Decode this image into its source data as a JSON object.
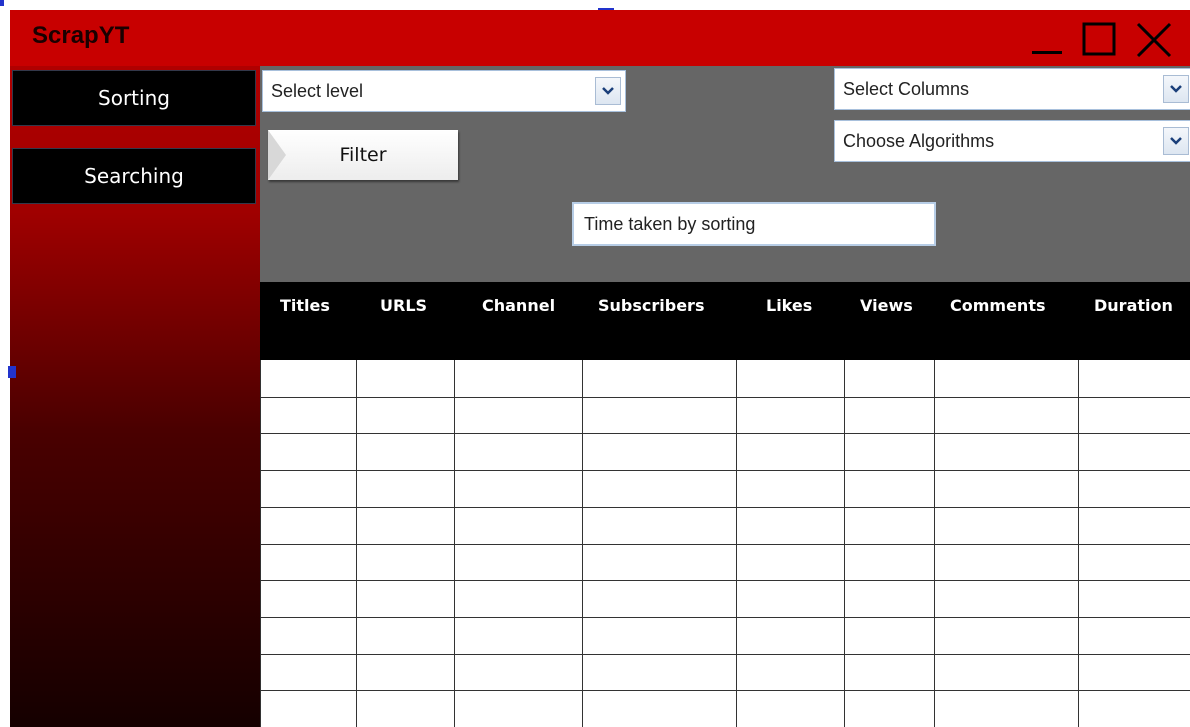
{
  "window": {
    "title": "ScrapYT",
    "controls": [
      "minimize-icon",
      "maximize-icon",
      "close-icon"
    ]
  },
  "sidebar": {
    "items": [
      {
        "label": "Sorting"
      },
      {
        "label": "Searching"
      }
    ]
  },
  "controls": {
    "level_select": {
      "value": "Select level"
    },
    "columns_select": {
      "value": "Select Columns"
    },
    "algorithms_select": {
      "value": "Choose Algorithms"
    },
    "filter_label": "Filter",
    "time_display": "Time taken by sorting"
  },
  "table": {
    "columns": [
      "Titles",
      "URLS",
      "Channel",
      "Subscribers",
      "Likes",
      "Views",
      "Comments",
      "Duration"
    ],
    "row_count": 10
  },
  "colors": {
    "titlebar": "#c80000",
    "panel": "#666666",
    "header": "#000000",
    "sidebar_top": "#b00000",
    "sidebar_bottom": "#150000"
  }
}
